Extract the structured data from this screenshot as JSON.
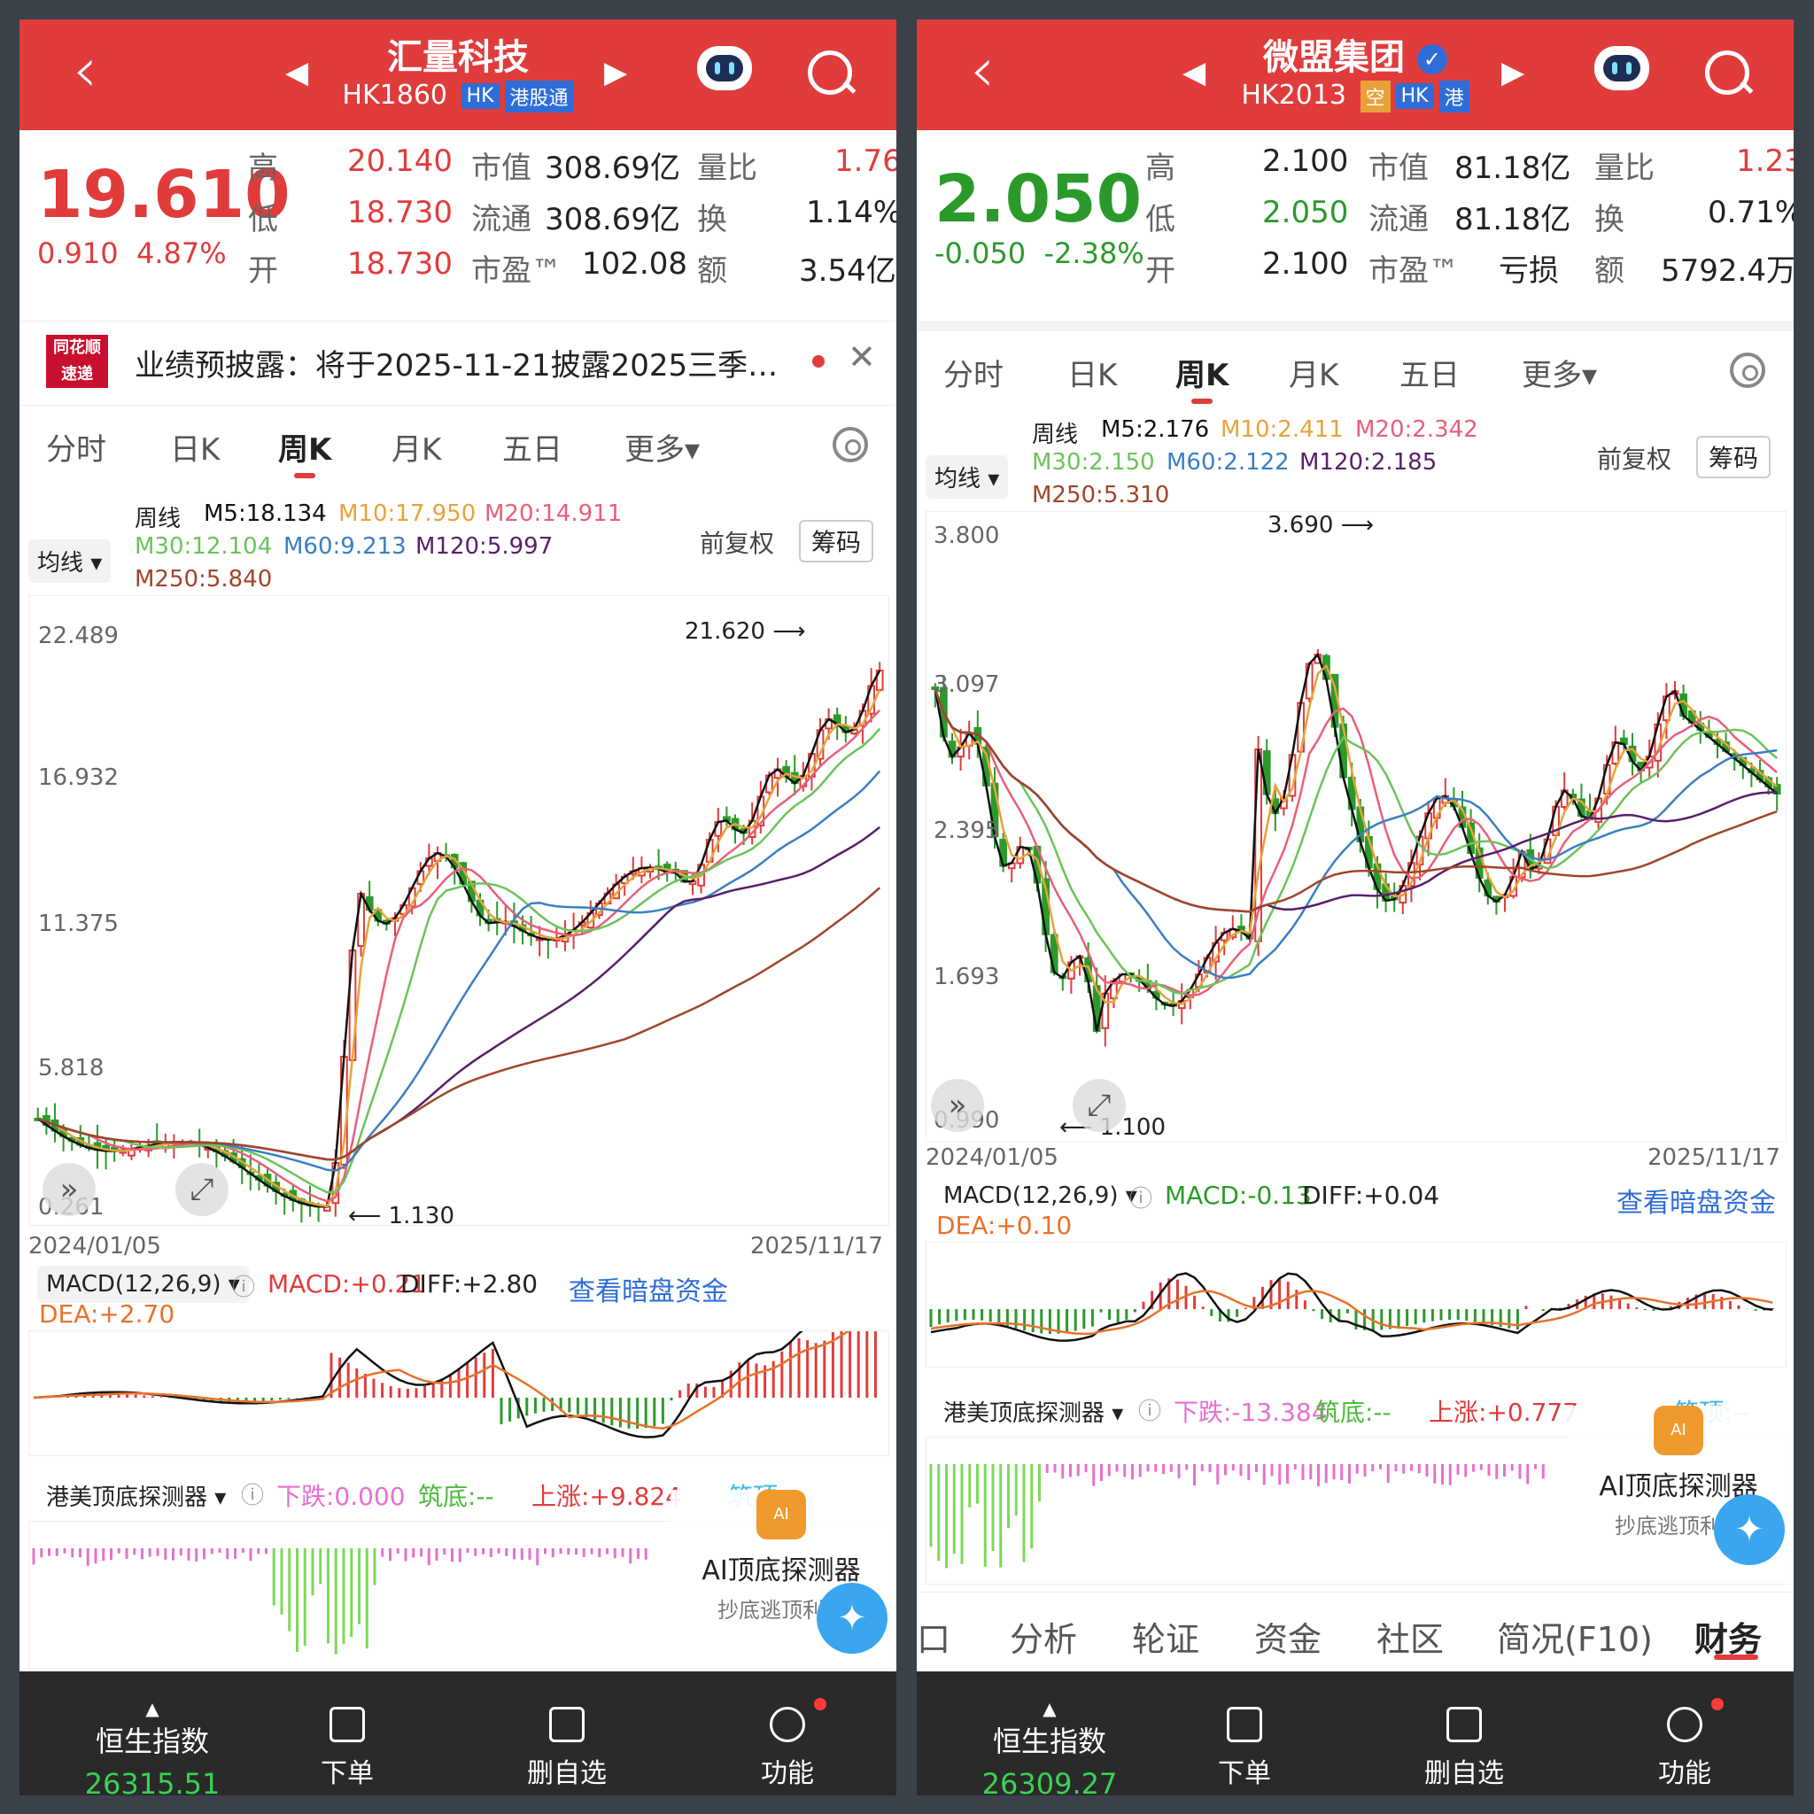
{
  "left": {
    "title": "汇量科技",
    "code": "HK1860",
    "tags": [
      "HK",
      "港股通"
    ],
    "price": "19.610",
    "change": "0.910",
    "change_pct": "4.87%",
    "quote": {
      "high_label": "高",
      "high": "20.140",
      "low_label": "低",
      "low": "18.730",
      "open_label": "开",
      "open": "18.730",
      "mcap_label": "市值",
      "mcap": "308.69亿",
      "float_label": "流通",
      "float": "308.69亿",
      "pe_label": "市盈™",
      "pe": "102.08",
      "vr_label": "量比",
      "vr": "1.76",
      "turn_label": "换",
      "turn": "1.14%",
      "amt_label": "额",
      "amt": "3.54亿"
    },
    "notice": {
      "logo": "同花顺 速递",
      "text": "业绩预披露：将于2025-11-21披露2025三季…"
    },
    "tabs": [
      "分时",
      "日K",
      "周K",
      "月K",
      "五日",
      "更多▾"
    ],
    "ma": {
      "button": "均线 ▾",
      "period": "周线",
      "m5": "M5:18.134",
      "m10": "M10:17.950",
      "m20": "M20:14.911",
      "m30": "M30:12.104",
      "m60": "M60:9.213",
      "m120": "M120:5.997",
      "m250": "M250:5.840",
      "adjust": "前复权",
      "chip": "筹码"
    },
    "yticks": [
      "22.489",
      "16.932",
      "11.375",
      "5.818",
      "0.261"
    ],
    "high_mark": "21.620",
    "low_mark": "1.130",
    "date_start": "2024/01/05",
    "date_end": "2025/11/17",
    "macd": {
      "name": "MACD(12,26,9) ▾",
      "macd": "MACD:+0.21",
      "diff": "DIFF:+2.80",
      "dea": "DEA:+2.70",
      "link": "查看暗盘资金"
    },
    "detector": {
      "name": "港美顶底探测器 ▾",
      "down": "下跌:0.000",
      "bottom": "筑底:--",
      "up": "上涨:+9.824",
      "top": "筑顶:--"
    },
    "ai": {
      "title": "AI顶底探测器",
      "sub": "抄底逃顶利器"
    },
    "bottom": {
      "index_name": "恒生指数",
      "index_value": "26315.51",
      "order": "下单",
      "remove": "删自选",
      "func": "功能"
    }
  },
  "right": {
    "title": "微盟集团",
    "code": "HK2013",
    "tags": [
      "空",
      "HK",
      "港"
    ],
    "price": "2.050",
    "change": "-0.050",
    "change_pct": "-2.38%",
    "quote": {
      "high_label": "高",
      "high": "2.100",
      "low_label": "低",
      "low": "2.050",
      "open_label": "开",
      "open": "2.100",
      "mcap_label": "市值",
      "mcap": "81.18亿",
      "float_label": "流通",
      "float": "81.18亿",
      "pe_label": "市盈™",
      "pe": "亏损",
      "vr_label": "量比",
      "vr": "1.23",
      "turn_label": "换",
      "turn": "0.71%",
      "amt_label": "额",
      "amt": "5792.4万"
    },
    "tabs": [
      "分时",
      "日K",
      "周K",
      "月K",
      "五日",
      "更多▾"
    ],
    "ma": {
      "button": "均线 ▾",
      "period": "周线",
      "m5": "M5:2.176",
      "m10": "M10:2.411",
      "m20": "M20:2.342",
      "m30": "M30:2.150",
      "m60": "M60:2.122",
      "m120": "M120:2.185",
      "m250": "M250:5.310",
      "adjust": "前复权",
      "chip": "筹码"
    },
    "yticks": [
      "3.800",
      "3.097",
      "2.395",
      "1.693",
      "0.990"
    ],
    "high_mark": "3.690",
    "low_mark": "1.100",
    "date_start": "2024/01/05",
    "date_end": "2025/11/17",
    "macd": {
      "name": "MACD(12,26,9) ▾",
      "macd": "MACD:-0.13",
      "diff": "DIFF:+0.04",
      "dea": "DEA:+0.10",
      "link": "查看暗盘资金"
    },
    "detector": {
      "name": "港美顶底探测器 ▾",
      "down": "下跌:-13.384",
      "bottom": "筑底:--",
      "up": "上涨:+0.777",
      "top": "筑顶:--"
    },
    "ai": {
      "title": "AI顶底探测器",
      "sub": "抄底逃顶利器"
    },
    "footer_tabs": [
      "口",
      "分析",
      "轮证",
      "资金",
      "社区",
      "简况(F10)",
      "财务"
    ],
    "bottom": {
      "index_name": "恒生指数",
      "index_value": "26309.27",
      "order": "下单",
      "remove": "删自选",
      "func": "功能"
    }
  },
  "colors": {
    "up": "#e03c3c",
    "down": "#2b9a2b",
    "m5": "#111111",
    "m10": "#e8a23a",
    "m20": "#e8607a",
    "m30": "#6bc45a",
    "m60": "#3a7fc4",
    "m120": "#5a1f6a",
    "m250": "#a0462a"
  }
}
